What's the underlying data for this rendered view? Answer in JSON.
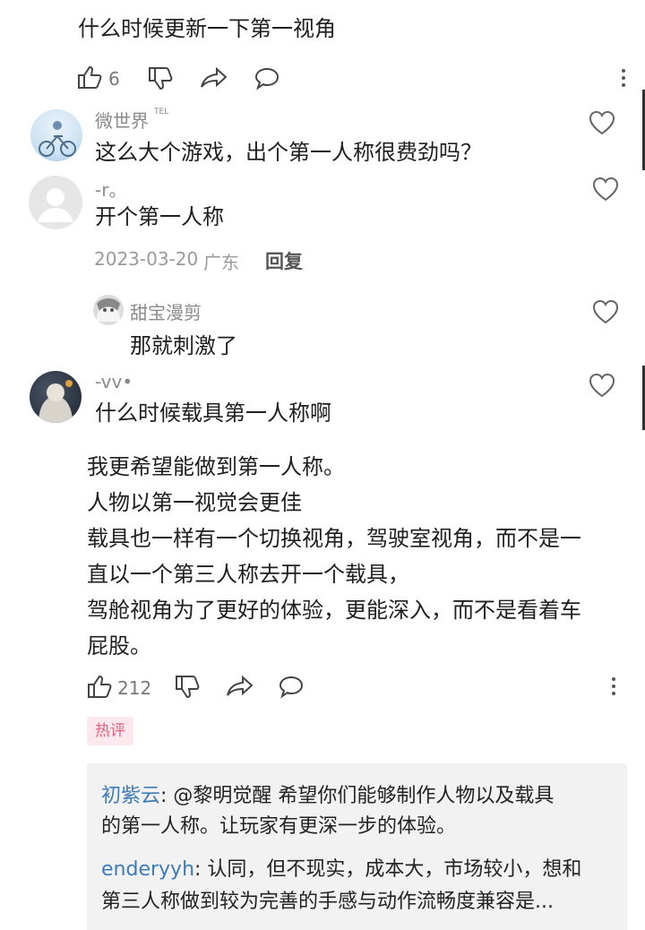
{
  "top_comment": {
    "text": "什么时候更新一下第一视角",
    "like_count": "6"
  },
  "replies": [
    {
      "name": "微世界",
      "badge": "TEL",
      "text": "这么大个游戏，出个第一人称很费劲吗？"
    },
    {
      "name": "-r。",
      "text": "开个第一人称",
      "date": "2023-03-20",
      "location": "广东",
      "reply_label": "回复"
    },
    {
      "name": "甜宝漫剪",
      "text": "那就刺激了"
    },
    {
      "name": "-vv•",
      "text": "什么时候载具第一人称啊"
    }
  ],
  "main_comment": {
    "lines": [
      "我更希望能做到第一人称。",
      "人物以第一视觉会更佳",
      "载具也一样有一个切换视角，驾驶室视角，而不是一",
      "直以一个第三人称去开一个载具，",
      "驾舱视角为了更好的体验，更能深入，而不是看着车",
      "屁股。"
    ],
    "like_count": "212"
  },
  "hot_badge": "热评",
  "hot_replies": [
    {
      "name": "初紫云",
      "line1": ": @黎明觉醒 希望你们能够制作人物以及载具",
      "line2": "的第一人称。让玩家有更深一步的体验。"
    },
    {
      "name": "enderyyh",
      "line1": ": 认同，但不现实，成本大，市场较小，想和",
      "line2": "第三人称做到较为完善的手感与动作流畅度兼容是..."
    }
  ],
  "colors": {
    "link": "#3d7bb8",
    "hot_badge_bg": "#fde8ee",
    "hot_badge_text": "#e8617f",
    "hot_box_bg": "#f2f2f2"
  },
  "icons": [
    "thumbs-up-icon",
    "thumbs-down-icon",
    "share-icon",
    "comment-icon",
    "more-icon",
    "heart-icon"
  ]
}
